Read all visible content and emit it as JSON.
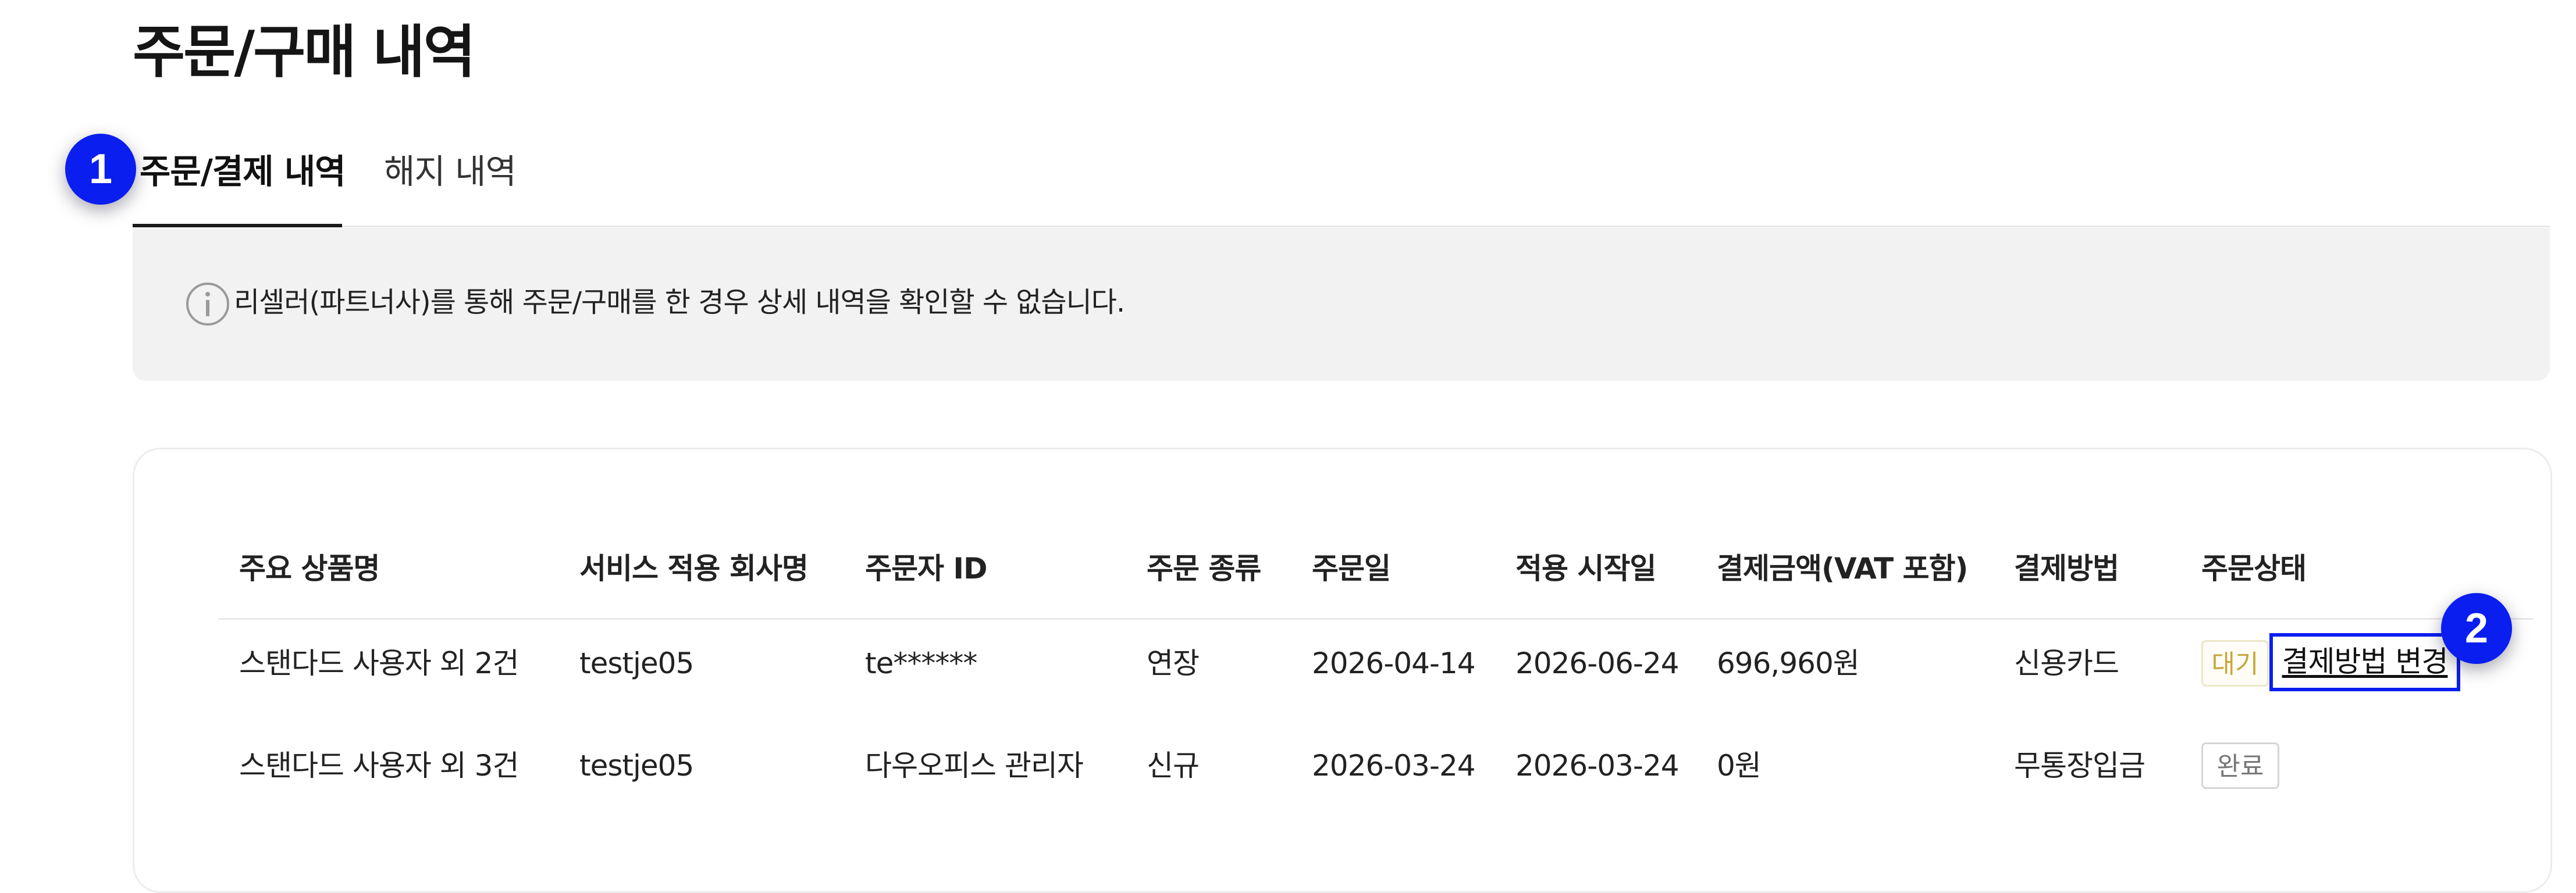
{
  "page": {
    "title": "주문/구매 내역"
  },
  "tabs": [
    {
      "label": "주문/결제 내역",
      "active": true
    },
    {
      "label": "해지 내역",
      "active": false
    }
  ],
  "markers": {
    "one": "1",
    "two": "2",
    "color": "#0a1ef0"
  },
  "notice": {
    "icon": "info-icon",
    "text": "리셀러(파트너사)를 통해 주문/구매를 한 경우 상세 내역을 확인할 수 없습니다."
  },
  "table": {
    "headers": [
      "주요 상품명",
      "서비스 적용 회사명",
      "주문자 ID",
      "주문 종류",
      "주문일",
      "적용 시작일",
      "결제금액(VAT 포함)",
      "결제방법",
      "주문상태"
    ],
    "rows": [
      {
        "product": "스탠다드 사용자 외 2건",
        "company": "testje05",
        "orderer": "te******",
        "type": "연장",
        "order_date": "2026-04-14",
        "start_date": "2026-06-24",
        "amount": "696,960원",
        "method": "신용카드",
        "status": "대기",
        "action": "결제방법 변경"
      },
      {
        "product": "스탠다드 사용자 외 3건",
        "company": "testje05",
        "orderer": "다우오피스 관리자",
        "type": "신규",
        "order_date": "2026-03-24",
        "start_date": "2026-03-24",
        "amount": "0원",
        "method": "무통장입금",
        "status": "완료"
      }
    ]
  }
}
